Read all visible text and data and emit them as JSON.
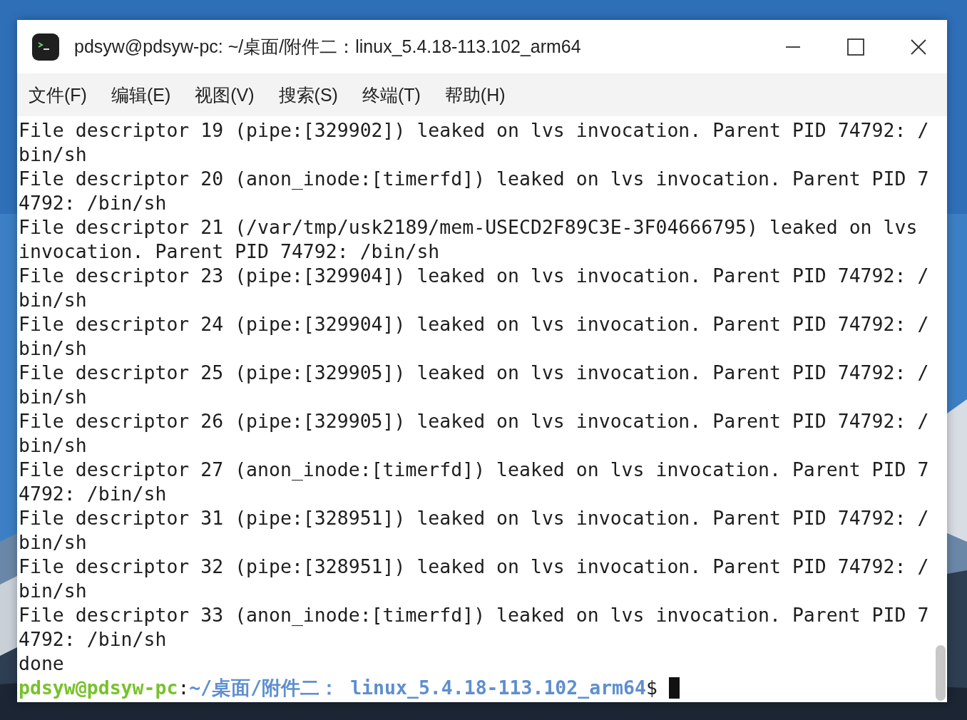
{
  "window": {
    "title": "pdsyw@pdsyw-pc: ~/桌面/附件二：linux_5.4.18-113.102_arm64"
  },
  "menu": [
    "文件(F)",
    "编辑(E)",
    "视图(V)",
    "搜索(S)",
    "终端(T)",
    "帮助(H)"
  ],
  "terminal": {
    "lines": [
      "File descriptor 19 (pipe:[329902]) leaked on lvs invocation. Parent PID 74792: /",
      "bin/sh",
      "File descriptor 20 (anon_inode:[timerfd]) leaked on lvs invocation. Parent PID 7",
      "4792: /bin/sh",
      "File descriptor 21 (/var/tmp/usk2189/mem-USECD2F89C3E-3F04666795) leaked on lvs",
      "invocation. Parent PID 74792: /bin/sh",
      "File descriptor 23 (pipe:[329904]) leaked on lvs invocation. Parent PID 74792: /",
      "bin/sh",
      "File descriptor 24 (pipe:[329904]) leaked on lvs invocation. Parent PID 74792: /",
      "bin/sh",
      "File descriptor 25 (pipe:[329905]) leaked on lvs invocation. Parent PID 74792: /",
      "bin/sh",
      "File descriptor 26 (pipe:[329905]) leaked on lvs invocation. Parent PID 74792: /",
      "bin/sh",
      "File descriptor 27 (anon_inode:[timerfd]) leaked on lvs invocation. Parent PID 7",
      "4792: /bin/sh",
      "File descriptor 31 (pipe:[328951]) leaked on lvs invocation. Parent PID 74792: /",
      "bin/sh",
      "File descriptor 32 (pipe:[328951]) leaked on lvs invocation. Parent PID 74792: /",
      "bin/sh",
      "File descriptor 33 (anon_inode:[timerfd]) leaked on lvs invocation. Parent PID 7",
      "4792: /bin/sh",
      "done"
    ],
    "prompt": {
      "user_host": "pdsyw@pdsyw-pc",
      "separator": ":",
      "path": "~/桌面/附件二： linux_5.4.18-113.102_arm64",
      "symbol": "$"
    }
  }
}
